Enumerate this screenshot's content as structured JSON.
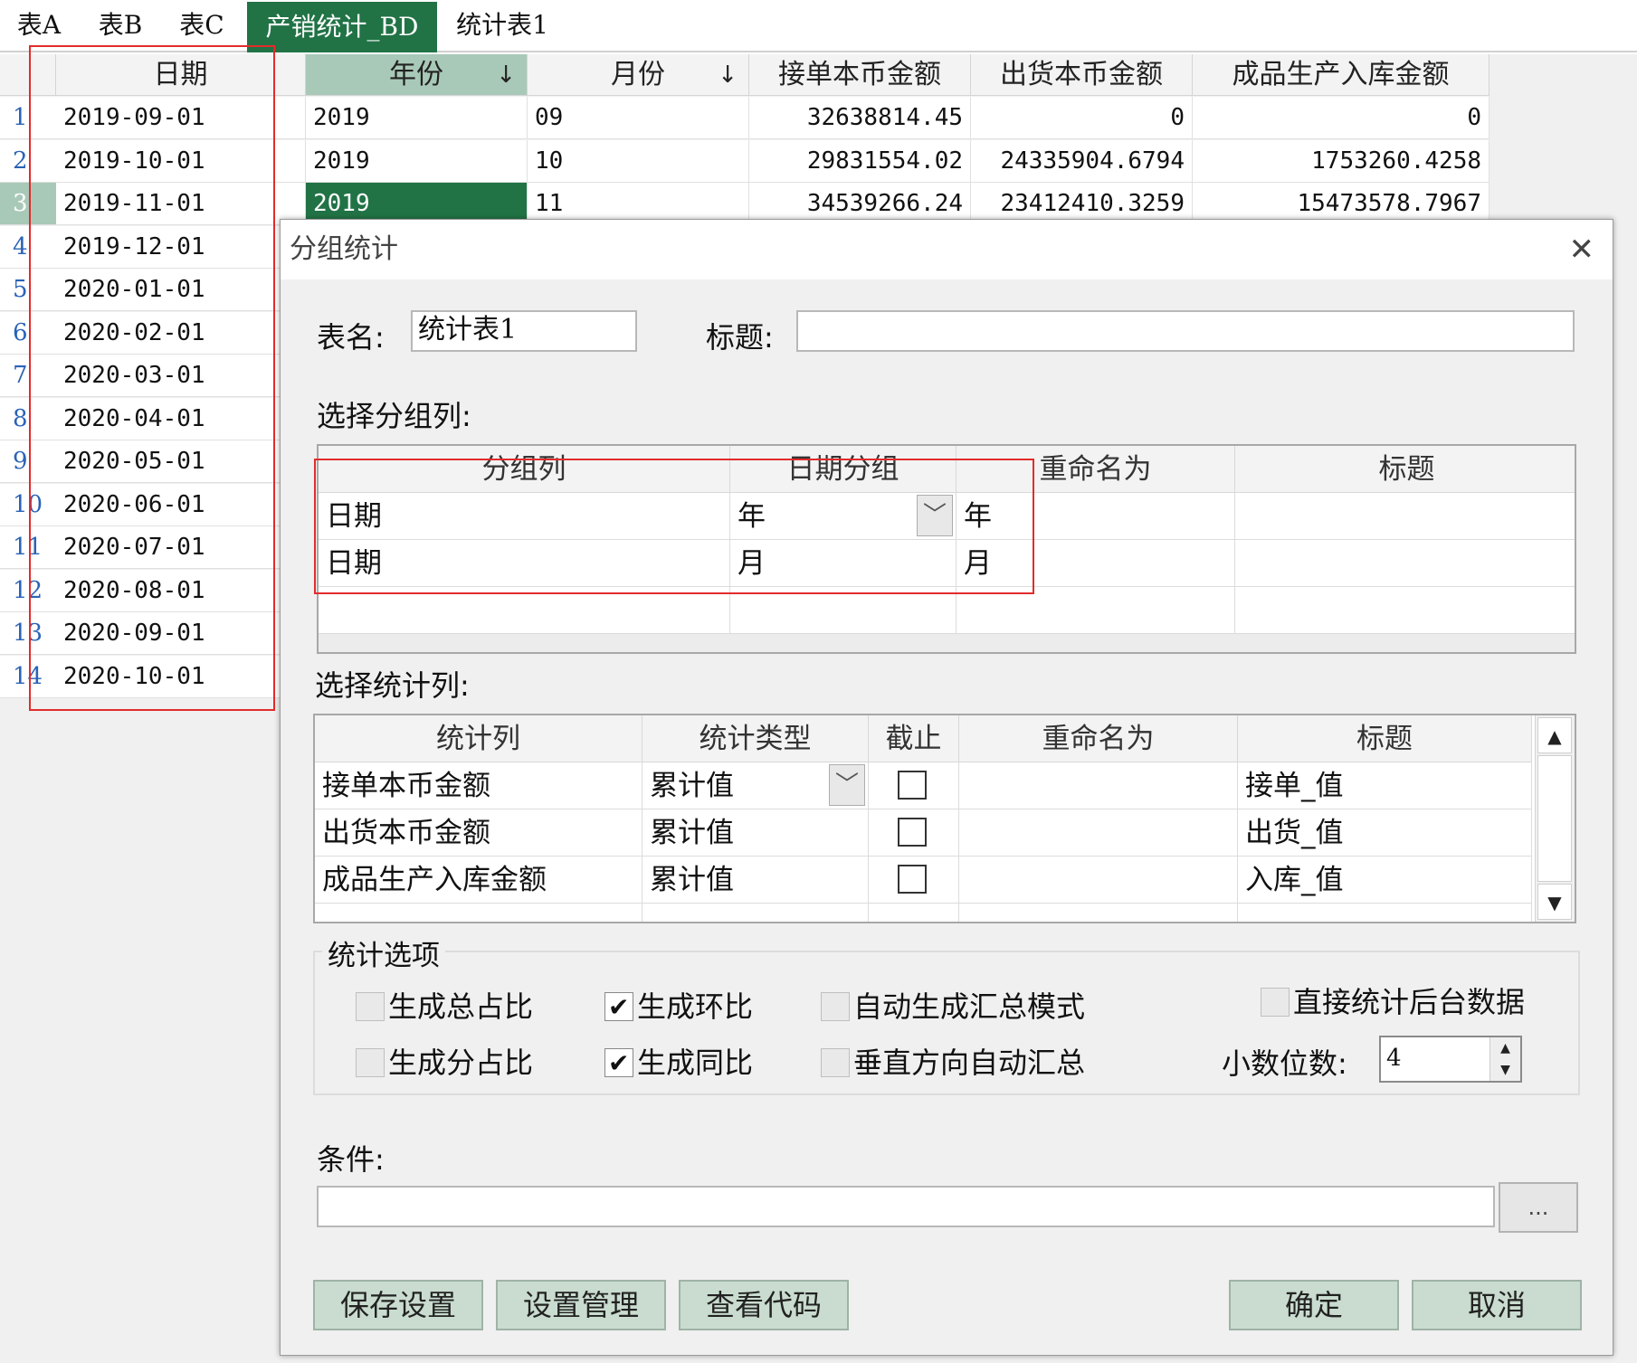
{
  "tabs": [
    {
      "label": "表A",
      "active": false
    },
    {
      "label": "表B",
      "active": false
    },
    {
      "label": "表C",
      "active": false
    },
    {
      "label": "产销统计_BD",
      "active": true
    },
    {
      "label": "统计表1",
      "active": false
    }
  ],
  "sheet": {
    "headers": {
      "date": "日期",
      "year": "年份",
      "month": "月份",
      "order_amount": "接单本币金额",
      "ship_amount": "出货本币金额",
      "production_amount": "成品生产入库金额"
    },
    "sort_icon": "down-arrow",
    "rows": [
      {
        "num": "1",
        "date": "2019-09-01",
        "year": "2019",
        "month": "09",
        "order": "32638814.45",
        "ship": "0",
        "prod": "0"
      },
      {
        "num": "2",
        "date": "2019-10-01",
        "year": "2019",
        "month": "10",
        "order": "29831554.02",
        "ship": "24335904.6794",
        "prod": "1753260.4258"
      },
      {
        "num": "3",
        "date": "2019-11-01",
        "year": "2019",
        "month": "11",
        "order": "34539266.24",
        "ship": "23412410.3259",
        "prod": "15473578.7967"
      },
      {
        "num": "4",
        "date": "2019-12-01"
      },
      {
        "num": "5",
        "date": "2020-01-01"
      },
      {
        "num": "6",
        "date": "2020-02-01"
      },
      {
        "num": "7",
        "date": "2020-03-01"
      },
      {
        "num": "8",
        "date": "2020-04-01"
      },
      {
        "num": "9",
        "date": "2020-05-01"
      },
      {
        "num": "10",
        "date": "2020-06-01"
      },
      {
        "num": "11",
        "date": "2020-07-01"
      },
      {
        "num": "12",
        "date": "2020-08-01"
      },
      {
        "num": "13",
        "date": "2020-09-01"
      },
      {
        "num": "14",
        "date": "2020-10-01"
      }
    ]
  },
  "dialog": {
    "title": "分组统计",
    "close_icon": "close-icon",
    "table_name_label": "表名:",
    "table_name_value": "统计表1",
    "title_label": "标题:",
    "title_value": "",
    "group_section_label": "选择分组列:",
    "group_headers": [
      "分组列",
      "日期分组",
      "重命名为",
      "标题"
    ],
    "group_rows": [
      {
        "col": "日期",
        "date_group": "年",
        "rename": "年",
        "title": ""
      },
      {
        "col": "日期",
        "date_group": "月",
        "rename": "月",
        "title": ""
      }
    ],
    "stat_section_label": "选择统计列:",
    "stat_headers": [
      "统计列",
      "统计类型",
      "截止",
      "重命名为",
      "标题"
    ],
    "stat_rows": [
      {
        "col": "接单本币金额",
        "type": "累计值",
        "cutoff": false,
        "rename": "",
        "title": "接单_值"
      },
      {
        "col": "出货本币金额",
        "type": "累计值",
        "cutoff": false,
        "rename": "",
        "title": "出货_值"
      },
      {
        "col": "成品生产入库金额",
        "type": "累计值",
        "cutoff": false,
        "rename": "",
        "title": "入库_值"
      }
    ],
    "options_legend": "统计选项",
    "options": {
      "total_ratio": {
        "label": "生成总占比",
        "checked": false
      },
      "mom": {
        "label": "生成环比",
        "checked": true
      },
      "auto_summary_mode": {
        "label": "自动生成汇总模式",
        "checked": false
      },
      "direct_backend": {
        "label": "直接统计后台数据",
        "checked": false
      },
      "sub_ratio": {
        "label": "生成分占比",
        "checked": false
      },
      "yoy": {
        "label": "生成同比",
        "checked": true
      },
      "vertical_auto_summary": {
        "label": "垂直方向自动汇总",
        "checked": false
      }
    },
    "decimal_label": "小数位数:",
    "decimal_value": "4",
    "condition_label": "条件:",
    "condition_value": "",
    "ellipsis": "...",
    "buttons": {
      "save_settings": "保存设置",
      "manage_settings": "设置管理",
      "view_code": "查看代码",
      "ok": "确定",
      "cancel": "取消"
    }
  }
}
